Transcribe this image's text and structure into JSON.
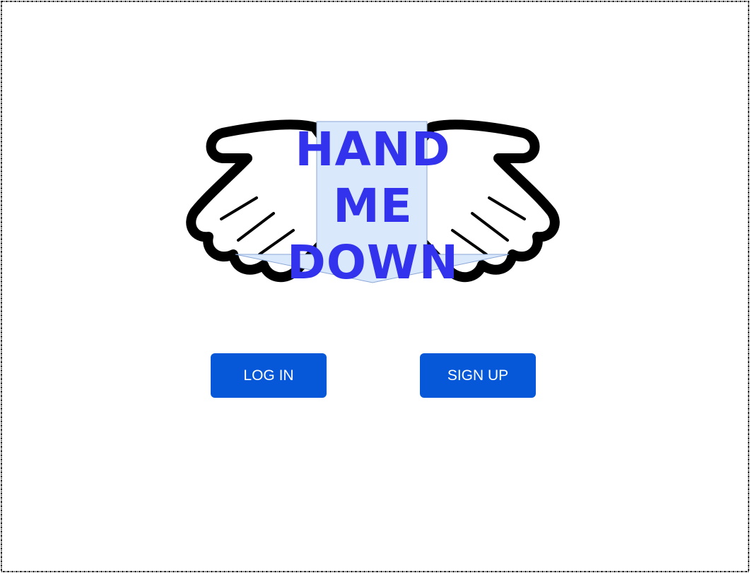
{
  "logo": {
    "lines": [
      "HAND",
      "ME",
      "DOWN"
    ],
    "text_color": "#3333ee",
    "ribbon_color": "#dae8fc",
    "icon": "open-hands-icon"
  },
  "buttons": {
    "login_label": "LOG IN",
    "signup_label": "SIGN UP",
    "color": "#0758d8"
  }
}
